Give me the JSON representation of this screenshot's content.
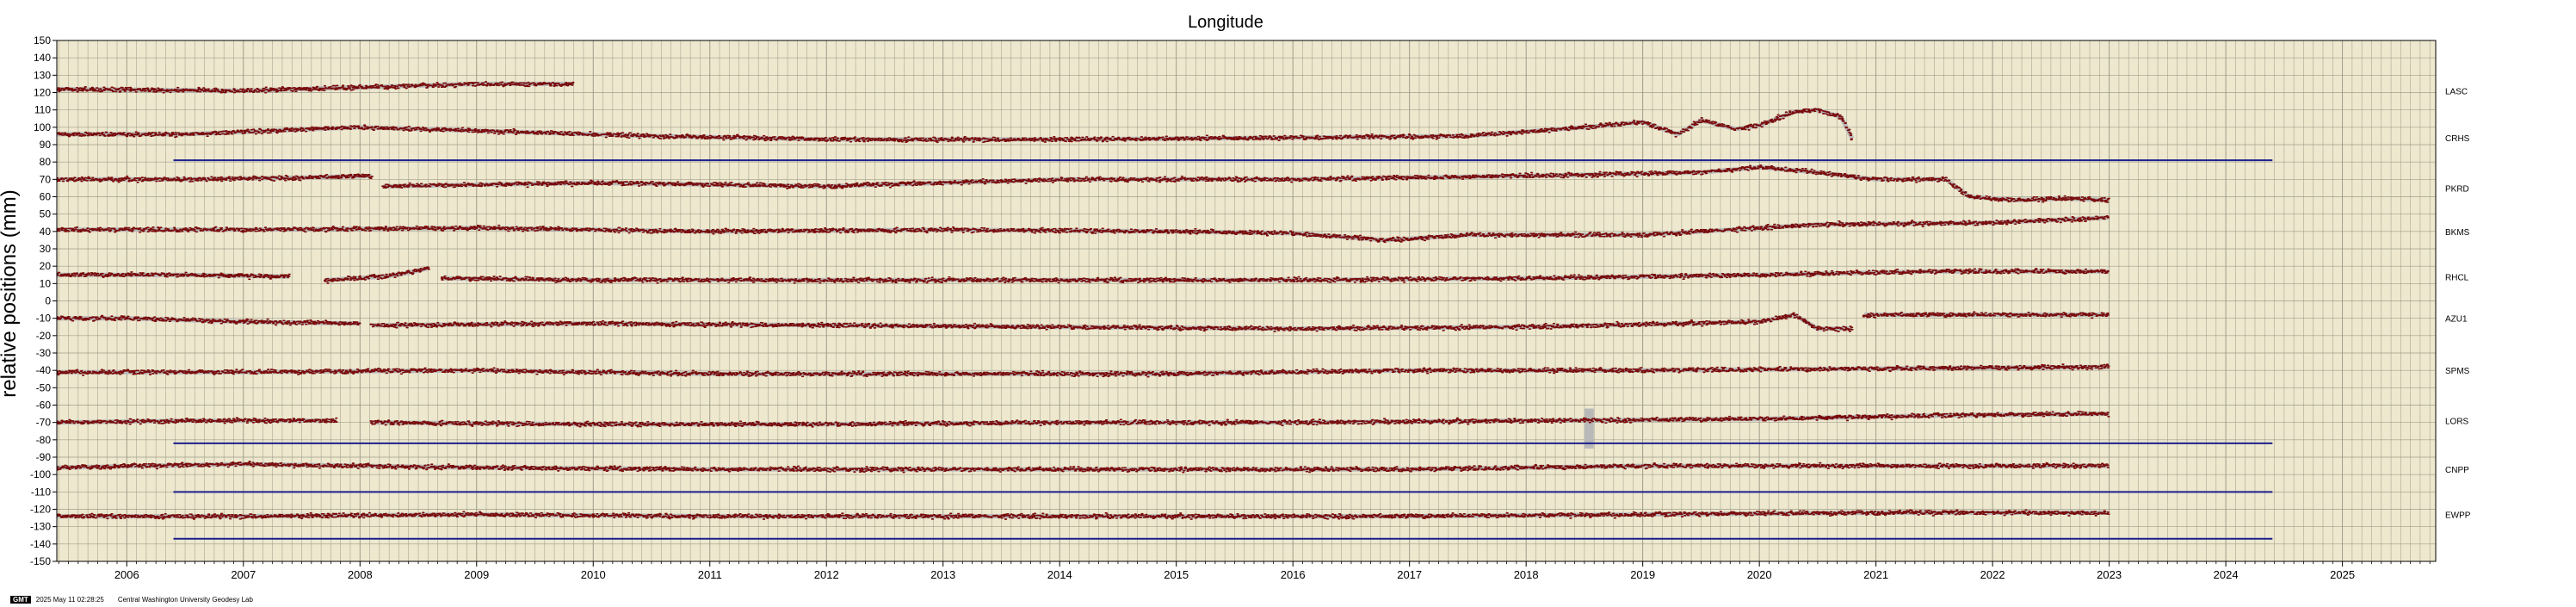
{
  "chart_data": {
    "type": "scatter",
    "title": "Longitude",
    "ylabel": "relative positions (mm)",
    "xlabel": "",
    "xlim": [
      2005.4,
      2025.8
    ],
    "ylim": [
      -150,
      150
    ],
    "x_ticks": [
      2006,
      2007,
      2008,
      2009,
      2010,
      2011,
      2012,
      2013,
      2014,
      2015,
      2016,
      2017,
      2018,
      2019,
      2020,
      2021,
      2022,
      2023,
      2024,
      2025
    ],
    "x_tick_labels": [
      "2006",
      "2007",
      "2008",
      "2009",
      "2010",
      "2011",
      "2012",
      "2013",
      "2014",
      "2015",
      "2016",
      "2017",
      "2018",
      "2019",
      "2020",
      "2021",
      "2022",
      "2023",
      "2024",
      "2025"
    ],
    "y_ticks": [
      -150,
      -140,
      -130,
      -120,
      -110,
      -100,
      -90,
      -80,
      -70,
      -60,
      -50,
      -40,
      -30,
      -20,
      -10,
      0,
      10,
      20,
      30,
      40,
      50,
      60,
      70,
      80,
      90,
      100,
      110,
      120,
      130,
      140,
      150
    ],
    "y_tick_labels": [
      "-150",
      "-140",
      "-130",
      "-120",
      "-110",
      "-100",
      "-90",
      "-80",
      "-70",
      "-60",
      "-50",
      "-40",
      "-30",
      "-20",
      "-10",
      "0",
      "10",
      "20",
      "30",
      "40",
      "50",
      "60",
      "70",
      "80",
      "90",
      "100",
      "110",
      "120",
      "130",
      "140",
      "150"
    ],
    "grid": true,
    "background_color": "#ede8ce",
    "grid_color": "#8f8c7c",
    "point_color": "#7a0c0c",
    "error_color": "#b9b9b9",
    "reference_line_color": "#1d1f8c",
    "series": [
      {
        "name": "LASC",
        "label_y": 121,
        "segments": [
          {
            "x": [
              2005.4,
              2007.0,
              2008.0,
              2009.0,
              2009.83
            ],
            "y": [
              122,
              121,
              123,
              125,
              125
            ]
          }
        ]
      },
      {
        "name": "CRHS",
        "label_y": 94,
        "segments": [
          {
            "x": [
              2005.4,
              2006.5,
              2008.0,
              2009.0,
              2010.5,
              2012.0,
              2014.0,
              2016.0,
              2017.5,
              2018.5,
              2019.0,
              2019.3,
              2019.5,
              2019.8,
              2020.0,
              2020.3,
              2020.5,
              2020.7,
              2020.8
            ],
            "y": [
              96,
              96,
              100,
              98,
              95,
              93,
              93,
              94,
              95,
              100,
              103,
              96,
              104,
              99,
              101,
              109,
              110,
              106,
              93
            ]
          }
        ]
      },
      {
        "name": "PKRD",
        "label_y": 65,
        "segments": [
          {
            "x": [
              2005.4,
              2006.5,
              2007.5,
              2008.1
            ],
            "y": [
              70,
              70,
              71,
              72
            ]
          },
          {
            "x": [
              2008.2,
              2010.0,
              2012.0,
              2014.0,
              2016.0,
              2018.0,
              2019.5,
              2020.0,
              2020.5,
              2021.0,
              2021.6,
              2021.8,
              2022.2,
              2022.6,
              2023.0
            ],
            "y": [
              66,
              68,
              66,
              70,
              70,
              72,
              74,
              77,
              74,
              70,
              70,
              60,
              58,
              59,
              58
            ]
          }
        ]
      },
      {
        "name": "BKMS",
        "label_y": 40,
        "segments": [
          {
            "x": [
              2005.4,
              2007.0,
              2009.0,
              2011.0,
              2013.0,
              2015.0,
              2016.0,
              2016.8,
              2017.5,
              2019.0,
              2019.5,
              2020.0,
              2020.5,
              2022.0,
              2023.0
            ],
            "y": [
              41,
              41,
              42,
              40,
              41,
              40,
              39,
              35,
              38,
              38,
              40,
              42,
              44,
              45,
              48
            ]
          }
        ]
      },
      {
        "name": "RHCL",
        "label_y": 14,
        "segments": [
          {
            "x": [
              2005.4,
              2006.5,
              2007.4
            ],
            "y": [
              15,
              15,
              14
            ]
          },
          {
            "x": [
              2007.7,
              2008.2,
              2008.4,
              2008.6
            ],
            "y": [
              12,
              14,
              16,
              19
            ]
          },
          {
            "x": [
              2008.7,
              2010.0,
              2012.0,
              2014.0,
              2016.0,
              2018.0,
              2020.0,
              2021.5,
              2023.0
            ],
            "y": [
              13,
              12,
              12,
              12,
              12,
              13,
              15,
              17,
              17
            ]
          }
        ]
      },
      {
        "name": "AZU1",
        "label_y": -10,
        "segments": [
          {
            "x": [
              2005.4,
              2006.0,
              2007.0,
              2008.0
            ],
            "y": [
              -10,
              -10,
              -12,
              -13
            ]
          },
          {
            "x": [
              2008.1,
              2010.0,
              2012.0,
              2014.0,
              2016.0,
              2018.0,
              2020.0,
              2020.3,
              2020.5,
              2020.8
            ],
            "y": [
              -14,
              -13,
              -14,
              -15,
              -16,
              -15,
              -12,
              -8,
              -16,
              -16
            ]
          },
          {
            "x": [
              2020.9,
              2022.0,
              2023.0
            ],
            "y": [
              -8,
              -8,
              -8
            ]
          }
        ]
      },
      {
        "name": "SPMS",
        "label_y": -40,
        "segments": [
          {
            "x": [
              2005.4,
              2007.0,
              2009.0,
              2011.0,
              2013.0,
              2015.0,
              2017.0,
              2019.0,
              2021.0,
              2023.0
            ],
            "y": [
              -41,
              -41,
              -40,
              -42,
              -42,
              -42,
              -40,
              -40,
              -39,
              -38
            ]
          }
        ]
      },
      {
        "name": "LORS",
        "label_y": -69,
        "segments": [
          {
            "x": [
              2005.4,
              2006.5,
              2007.8
            ],
            "y": [
              -70,
              -69,
              -69
            ]
          },
          {
            "x": [
              2008.1,
              2010.0,
              2012.0,
              2014.0,
              2016.0,
              2018.0,
              2020.0,
              2021.5,
              2023.0
            ],
            "y": [
              -70,
              -71,
              -71,
              -70,
              -70,
              -69,
              -68,
              -66,
              -65
            ]
          }
        ]
      },
      {
        "name": "CNPP",
        "label_y": -97,
        "segments": [
          {
            "x": [
              2005.4,
              2007.0,
              2009.0,
              2011.0,
              2013.0,
              2015.0,
              2017.0,
              2019.0,
              2021.0,
              2023.0
            ],
            "y": [
              -96,
              -94,
              -96,
              -97,
              -97,
              -97,
              -97,
              -95,
              -95,
              -95
            ]
          }
        ]
      },
      {
        "name": "EWPP",
        "label_y": -123,
        "segments": [
          {
            "x": [
              2005.4,
              2007.0,
              2009.0,
              2011.0,
              2013.0,
              2015.0,
              2017.0,
              2019.0,
              2021.0,
              2023.0
            ],
            "y": [
              -124,
              -124,
              -123,
              -124,
              -124,
              -124,
              -124,
              -123,
              -122,
              -122
            ]
          }
        ]
      }
    ],
    "reference_lines": [
      {
        "y": 81,
        "x": [
          2006.4,
          2024.4
        ]
      },
      {
        "y": -82,
        "x": [
          2006.4,
          2024.4
        ]
      },
      {
        "y": -110,
        "x": [
          2006.4,
          2024.4
        ]
      },
      {
        "y": -137,
        "x": [
          2006.4,
          2024.4
        ]
      }
    ],
    "highlight_band": {
      "x": [
        2018.5,
        2018.58
      ],
      "y": [
        -85,
        -62
      ]
    }
  },
  "footer": {
    "badge": "GMT",
    "timestamp": "2025 May 11 02:28:25",
    "credit": "Central Washington University Geodesy Lab"
  }
}
